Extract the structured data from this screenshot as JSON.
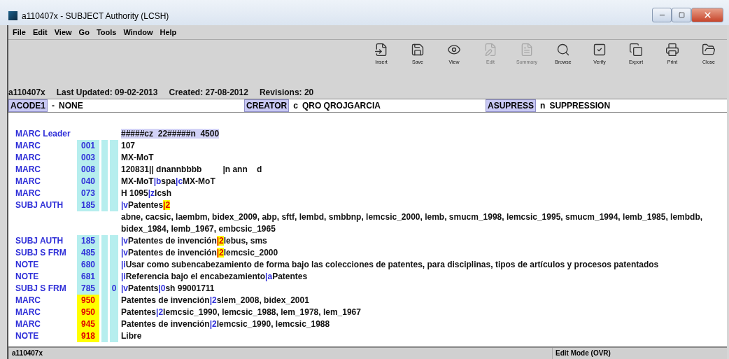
{
  "window": {
    "title": "a110407x - SUBJECT Authority (LCSH)"
  },
  "menu": [
    "File",
    "Edit",
    "View",
    "Go",
    "Tools",
    "Window",
    "Help"
  ],
  "toolbar": [
    {
      "kind": "insert",
      "label": "Insert",
      "disabled": false
    },
    {
      "kind": "save",
      "label": "Save",
      "disabled": false
    },
    {
      "kind": "view",
      "label": "View",
      "disabled": false
    },
    {
      "kind": "edit",
      "label": "Edit",
      "disabled": true
    },
    {
      "kind": "summary",
      "label": "Summary",
      "disabled": true
    },
    {
      "kind": "browse",
      "label": "Browse",
      "disabled": false
    },
    {
      "kind": "verify",
      "label": "Verify",
      "disabled": false
    },
    {
      "kind": "export",
      "label": "Export",
      "disabled": false
    },
    {
      "kind": "print",
      "label": "Print",
      "disabled": false
    },
    {
      "kind": "close",
      "label": "Close",
      "disabled": false
    }
  ],
  "info": {
    "record": "a110407x",
    "updated": "Last Updated: 09-02-2013",
    "created": "Created: 27-08-2012",
    "revisions": "Revisions: 20"
  },
  "header_fields": [
    {
      "label": "ACODE1",
      "code": "-",
      "value": "NONE"
    },
    {
      "label": "CREATOR",
      "code": "c",
      "value": "QRO QROJGARCIA"
    },
    {
      "label": "ASUPRESS",
      "code": "n",
      "value": "SUPPRESSION"
    }
  ],
  "rows": [
    {
      "kind": "leader",
      "label": "MARC Leader",
      "content": [
        {
          "kind": "leader",
          "text": "#####cz  22#####n  4500"
        }
      ]
    },
    {
      "kind": "field",
      "label": "MARC",
      "tag": "001",
      "flagged": false,
      "content": [
        {
          "kind": "plain",
          "text": "107"
        }
      ]
    },
    {
      "kind": "field",
      "label": "MARC",
      "tag": "003",
      "flagged": false,
      "content": [
        {
          "kind": "plain",
          "text": "MX-MoT"
        }
      ]
    },
    {
      "kind": "field",
      "label": "MARC",
      "tag": "008",
      "flagged": false,
      "content": [
        {
          "kind": "plain",
          "text": "120831|| dnannbbbb         |n ann    d"
        }
      ]
    },
    {
      "kind": "field",
      "label": "MARC",
      "tag": "040",
      "flagged": false,
      "content": [
        {
          "kind": "plain",
          "text": "MX-MoT"
        },
        {
          "kind": "subfield",
          "text": "|b"
        },
        {
          "kind": "plain",
          "text": "spa"
        },
        {
          "kind": "subfield",
          "text": "|c"
        },
        {
          "kind": "plain",
          "text": "MX-MoT"
        }
      ]
    },
    {
      "kind": "field",
      "label": "MARC",
      "tag": "073",
      "flagged": false,
      "content": [
        {
          "kind": "plain",
          "text": "H 1095"
        },
        {
          "kind": "subfield",
          "text": "|z"
        },
        {
          "kind": "plain",
          "text": "lcsh"
        }
      ]
    },
    {
      "kind": "field",
      "label": "SUBJ AUTH",
      "tag": "185",
      "flagged": false,
      "content": [
        {
          "kind": "subfield",
          "text": "|v"
        },
        {
          "kind": "plain",
          "text": "Patentes"
        },
        {
          "kind": "flag",
          "text": "|2"
        }
      ]
    },
    {
      "kind": "continuation",
      "content": [
        {
          "kind": "plain",
          "text": "abne, cacsic, laembm, bidex_2009, abp, sftf, lembd, smbbnp, lemcsic_2000, lemb, smucm_1998, lemcsic_1995, smucm_1994, lemb_1985, lembdb, bidex_1984, lemb_1967, embcsic_1965"
        }
      ]
    },
    {
      "kind": "field",
      "label": "SUBJ AUTH",
      "tag": "185",
      "flagged": false,
      "content": [
        {
          "kind": "subfield",
          "text": "|v"
        },
        {
          "kind": "plain",
          "text": "Patentes de invención"
        },
        {
          "kind": "flag",
          "text": "|2"
        },
        {
          "kind": "plain",
          "text": "lebus, sms"
        }
      ]
    },
    {
      "kind": "field",
      "label": "SUBJ S FRM",
      "tag": "485",
      "flagged": false,
      "content": [
        {
          "kind": "subfield",
          "text": "|v"
        },
        {
          "kind": "plain",
          "text": "Patentes de invención"
        },
        {
          "kind": "flag",
          "text": "|2"
        },
        {
          "kind": "plain",
          "text": "lemcsic_2000"
        }
      ]
    },
    {
      "kind": "field",
      "label": "NOTE",
      "tag": "680",
      "flagged": false,
      "content": [
        {
          "kind": "subfield",
          "text": "|i"
        },
        {
          "kind": "plain",
          "text": "Usar como subencabezamiento de forma bajo las colecciones de patentes, para disciplinas, tipos de artículos y procesos patentados"
        }
      ]
    },
    {
      "kind": "field",
      "label": "NOTE",
      "tag": "681",
      "flagged": false,
      "content": [
        {
          "kind": "subfield",
          "text": "|i"
        },
        {
          "kind": "plain",
          "text": "Referencia bajo el encabezamiento"
        },
        {
          "kind": "subfield",
          "text": "|a"
        },
        {
          "kind": "plain",
          "text": "Patentes"
        }
      ]
    },
    {
      "kind": "field",
      "label": "SUBJ S FRM",
      "tag": "785",
      "ind2": "0",
      "flagged": false,
      "content": [
        {
          "kind": "subfield",
          "text": "|v"
        },
        {
          "kind": "plain",
          "text": "Patents"
        },
        {
          "kind": "subfield",
          "text": "|0"
        },
        {
          "kind": "plain",
          "text": "sh 99001711"
        }
      ]
    },
    {
      "kind": "field",
      "label": "MARC",
      "tag": "950",
      "flagged": true,
      "content": [
        {
          "kind": "plain",
          "text": "Patentes de invención"
        },
        {
          "kind": "subfield",
          "text": "|2"
        },
        {
          "kind": "plain",
          "text": "slem_2008, bidex_2001"
        }
      ]
    },
    {
      "kind": "field",
      "label": "MARC",
      "tag": "950",
      "flagged": true,
      "content": [
        {
          "kind": "plain",
          "text": "Patentes"
        },
        {
          "kind": "subfield",
          "text": "|2"
        },
        {
          "kind": "plain",
          "text": "lemcsic_1990, lemcsic_1988, lem_1978, lem_1967"
        }
      ]
    },
    {
      "kind": "field",
      "label": "MARC",
      "tag": "945",
      "flagged": true,
      "content": [
        {
          "kind": "plain",
          "text": "Patentes de invención"
        },
        {
          "kind": "subfield",
          "text": "|2"
        },
        {
          "kind": "plain",
          "text": "lemcsic_1990, lemcsic_1988"
        }
      ]
    },
    {
      "kind": "field",
      "label": "NOTE",
      "tag": "918",
      "flagged": true,
      "content": [
        {
          "kind": "plain",
          "text": "Libre"
        }
      ]
    }
  ],
  "status_bar": {
    "record": "a110407x",
    "mode": "Edit Mode (OVR)"
  }
}
